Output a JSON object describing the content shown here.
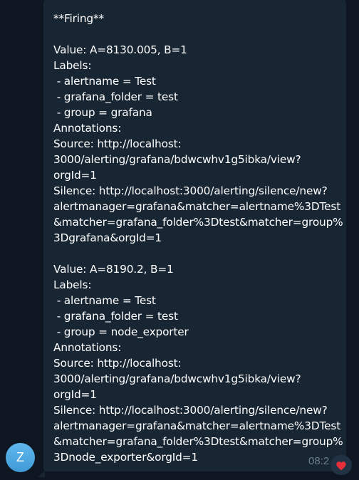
{
  "chat": {
    "avatar_initial": "Z",
    "message": {
      "text": "**Firing**\n\nValue: A=8130.005, B=1\nLabels:\n - alertname = Test\n - grafana_folder = test\n - group = grafana\nAnnotations:\nSource: http://localhost:\n3000/alerting/grafana/bdwcwhv1g5ibka/view?\norgId=1\nSilence: http://localhost:3000/alerting/silence/new?\nalertmanager=grafana&matcher=alertname%3DTest\n&matcher=grafana_folder%3Dtest&matcher=group%\n3Dgrafana&orgId=1\n\nValue: A=8190.2, B=1\nLabels:\n - alertname = Test\n - grafana_folder = test\n - group = node_exporter\nAnnotations:\nSource: http://localhost:\n3000/alerting/grafana/bdwcwhv1g5ibka/view?\norgId=1\nSilence: http://localhost:3000/alerting/silence/new?\nalertmanager=grafana&matcher=alertname%3DTest\n&matcher=grafana_folder%3Dtest&matcher=group%\n3Dnode_exporter&orgId=1",
      "time": "08:2",
      "reaction_icon": "heart-icon"
    }
  },
  "colors": {
    "background": "#0e1621",
    "bubble": "#182533",
    "text": "#ffffff",
    "timestamp": "#6d7f8f",
    "avatar": "#4fa7e3",
    "reaction": "#e5303b"
  }
}
